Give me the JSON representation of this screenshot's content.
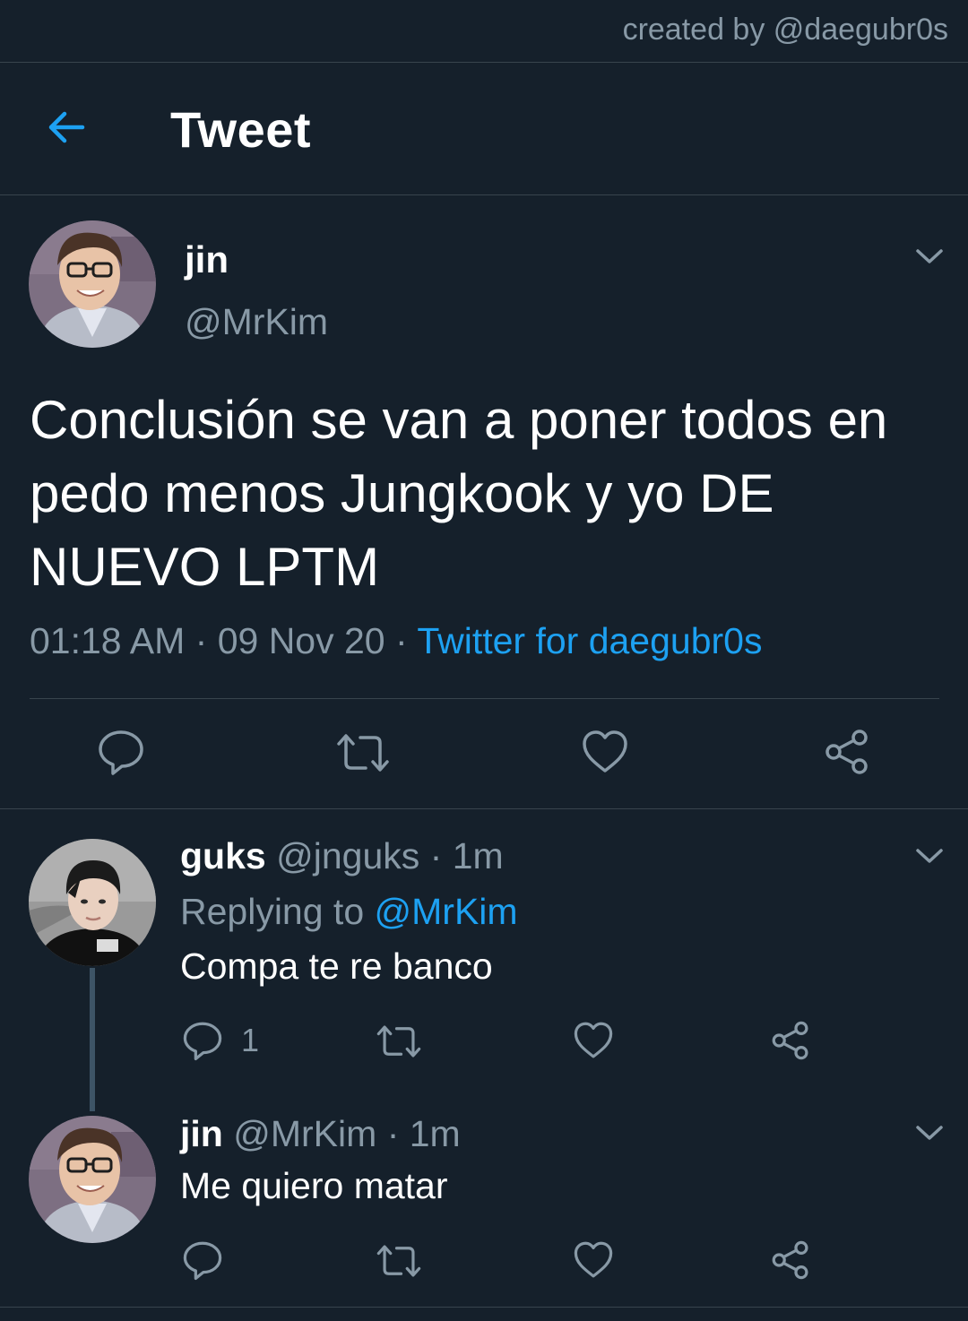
{
  "credit": "created by @daegubr0s",
  "header": {
    "title": "Tweet",
    "back_icon": "arrow-left-icon",
    "accent": "#1da1f2"
  },
  "main_tweet": {
    "display_name": "jin",
    "handle": "@MrKim",
    "text": "Conclusión se van a poner todos en pedo menos Jungkook y yo DE NUEVO LPTM",
    "time": "01:18 AM",
    "date": "09 Nov 20",
    "source": "Twitter for daegubr0s",
    "sep": "·"
  },
  "replies": [
    {
      "display_name": "guks",
      "handle": "@jnguks",
      "age": "1m",
      "replying_prefix": "Replying to",
      "replying_handle": "@MrKim",
      "text": "Compa te re banco",
      "reply_count": "1"
    },
    {
      "display_name": "jin",
      "handle": "@MrKim",
      "age": "1m",
      "text": "Me quiero matar"
    }
  ],
  "colors": {
    "background": "#15202b",
    "divider": "#38444d",
    "muted": "#8899a6",
    "link": "#1da1f2"
  }
}
